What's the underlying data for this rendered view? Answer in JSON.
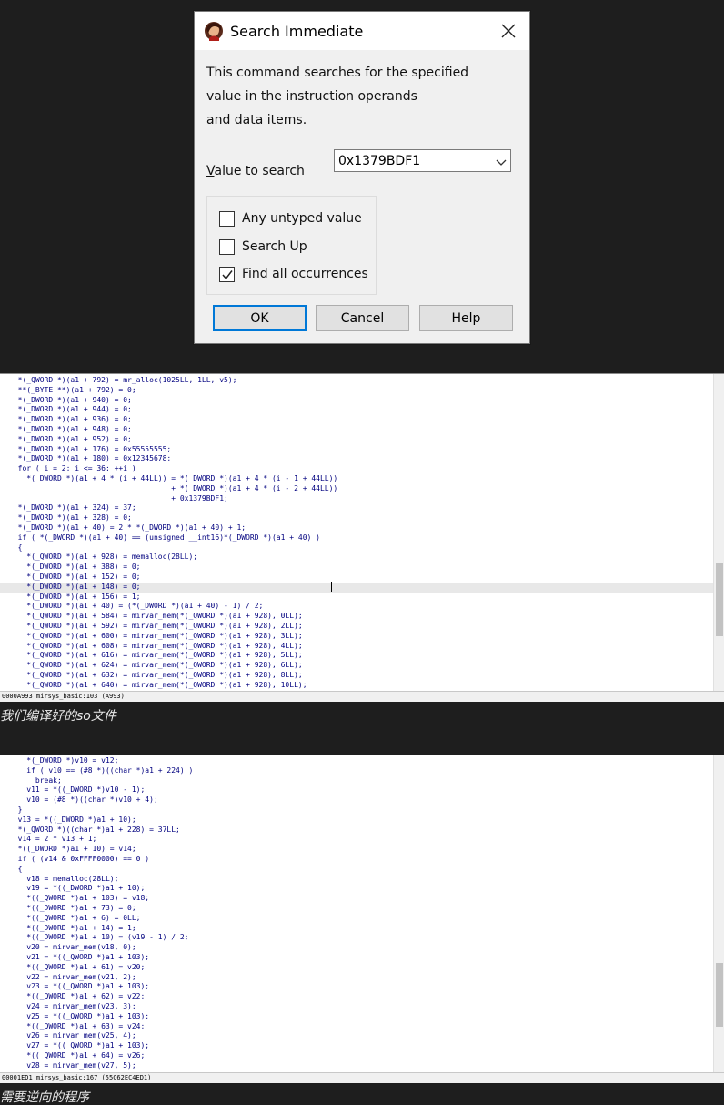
{
  "dialog": {
    "title": "Search Immediate",
    "description": [
      "This command searches for the specified",
      "value in the instruction operands",
      "and data items."
    ],
    "value_label_accel": "V",
    "value_label_rest": "alue to search",
    "value": "0x1379BDF1",
    "checkboxes": [
      {
        "label": "Any untyped value",
        "checked": false
      },
      {
        "label": "Search Up",
        "checked": false
      },
      {
        "label": "Find all occurrences",
        "checked": true
      }
    ],
    "ok_label": "OK",
    "cancel_label": "Cancel",
    "help_label": "Help"
  },
  "pane1": {
    "lines": [
      "  *(_QWORD *)(a1 + 792) = mr_alloc(1025LL, 1LL, v5);",
      "  **(_BYTE **)(a1 + 792) = 0;",
      "  *(_DWORD *)(a1 + 940) = 0;",
      "  *(_DWORD *)(a1 + 944) = 0;",
      "  *(_DWORD *)(a1 + 936) = 0;",
      "  *(_DWORD *)(a1 + 948) = 0;",
      "  *(_DWORD *)(a1 + 952) = 0;",
      "  *(_DWORD *)(a1 + 176) = 0x55555555;",
      "  *(_DWORD *)(a1 + 180) = 0x12345678;",
      "  for ( i = 2; i <= 36; ++i )",
      "    *(_DWORD *)(a1 + 4 * (i + 44LL)) = *(_DWORD *)(a1 + 4 * (i - 1 + 44LL))",
      "                                     + *(_DWORD *)(a1 + 4 * (i - 2 + 44LL))",
      "                                     + 0x1379BDF1;",
      "  *(_DWORD *)(a1 + 324) = 37;",
      "  *(_DWORD *)(a1 + 328) = 0;",
      "  *(_DWORD *)(a1 + 40) = 2 * *(_DWORD *)(a1 + 40) + 1;",
      "  if ( *(_DWORD *)(a1 + 40) == (unsigned __int16)*(_DWORD *)(a1 + 40) )",
      "  {",
      "    *(_QWORD *)(a1 + 928) = memalloc(28LL);",
      "    *(_DWORD *)(a1 + 388) = 0;",
      "    *(_DWORD *)(a1 + 152) = 0;",
      "    *(_DWORD *)(a1 + 148) = 0;",
      "    *(_DWORD *)(a1 + 156) = 1;",
      "    *(_DWORD *)(a1 + 40) = (*(_DWORD *)(a1 + 40) - 1) / 2;",
      "    *(_QWORD *)(a1 + 584) = mirvar_mem(*(_QWORD *)(a1 + 928), 0LL);",
      "    *(_QWORD *)(a1 + 592) = mirvar_mem(*(_QWORD *)(a1 + 928), 2LL);",
      "    *(_QWORD *)(a1 + 600) = mirvar_mem(*(_QWORD *)(a1 + 928), 3LL);",
      "    *(_QWORD *)(a1 + 608) = mirvar_mem(*(_QWORD *)(a1 + 928), 4LL);",
      "    *(_QWORD *)(a1 + 616) = mirvar_mem(*(_QWORD *)(a1 + 928), 5LL);",
      "    *(_QWORD *)(a1 + 624) = mirvar_mem(*(_QWORD *)(a1 + 928), 6LL);",
      "    *(_QWORD *)(a1 + 632) = mirvar_mem(*(_QWORD *)(a1 + 928), 8LL);",
      "    *(_QWORD *)(a1 + 640) = mirvar_mem(*(_QWORD *)(a1 + 928), 10LL);"
    ],
    "status": "0000A993 mirsys_basic:103 (A993)"
  },
  "caption1": "我们编译好的so文件",
  "pane2": {
    "lines": [
      "    *(_DWORD *)v10 = v12;",
      "    if ( v10 == (#8 *)((char *)a1 + 224) )",
      "      break;",
      "    v11 = *((_DWORD *)v10 - 1);",
      "    v10 = (#8 *)((char *)v10 + 4);",
      "  }",
      "  v13 = *((_DWORD *)a1 + 10);",
      "  *(_QWORD *)((char *)a1 + 228) = 37LL;",
      "  v14 = 2 * v13 + 1;",
      "  *((_DWORD *)a1 + 10) = v14;",
      "  if ( (v14 & 0xFFFF0000) == 0 )",
      "  {",
      "    v18 = memalloc(28LL);",
      "    v19 = *((_DWORD *)a1 + 10);",
      "    *((_QWORD *)a1 + 103) = v18;",
      "    *((_DWORD *)a1 + 73) = 0;",
      "    *((_QWORD *)a1 + 6) = 0LL;",
      "    *((_DWORD *)a1 + 14) = 1;",
      "    *((_DWORD *)a1 + 10) = (v19 - 1) / 2;",
      "    v20 = mirvar_mem(v18, 0);",
      "    v21 = *((_QWORD *)a1 + 103);",
      "    *((_QWORD *)a1 + 61) = v20;",
      "    v22 = mirvar_mem(v21, 2);",
      "    v23 = *((_QWORD *)a1 + 103);",
      "    *((_QWORD *)a1 + 62) = v22;",
      "    v24 = mirvar_mem(v23, 3);",
      "    v25 = *((_QWORD *)a1 + 103);",
      "    *((_QWORD *)a1 + 63) = v24;",
      "    v26 = mirvar_mem(v25, 4);",
      "    v27 = *((_QWORD *)a1 + 103);",
      "    *((_QWORD *)a1 + 64) = v26;",
      "    v28 = mirvar_mem(v27, 5);"
    ],
    "status": "00001ED1 mirsys_basic:167 (55C62EC4ED1)"
  },
  "caption2": "需要逆向的程序",
  "icons": {
    "app": "ida-app-icon",
    "close": "close-icon",
    "dropdown": "chevron-down-icon",
    "check": "checkmark-icon"
  },
  "colors": {
    "code_text": "#00007f",
    "dialog_bg": "#f0f0f0",
    "accent": "#0078d7",
    "page_bg": "#1e1e1e"
  }
}
